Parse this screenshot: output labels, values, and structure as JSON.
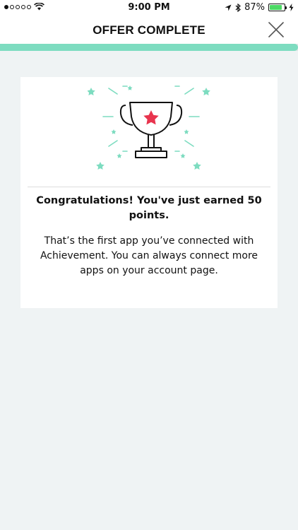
{
  "status_bar": {
    "time": "9:00 PM",
    "battery_percent": "87%",
    "battery_level": 0.87,
    "icons": [
      "signal-dots-icon",
      "wifi-icon",
      "location-arrow-icon",
      "bluetooth-icon",
      "battery-icon",
      "charging-bolt-icon"
    ]
  },
  "nav": {
    "title": "OFFER COMPLETE",
    "close_icon": "close-icon"
  },
  "progress": {
    "fraction": 1.0,
    "color": "#7ddcc0"
  },
  "card": {
    "illustration_icon": "trophy-star-icon",
    "headline": "Congratulations! You've just earned 50 points.",
    "body": "That’s the first app you’ve connected with Achievement. You can always connect more apps on your account page."
  },
  "colors": {
    "accent": "#7ddcc0",
    "star": "#e8344e",
    "background": "#eff3f4"
  }
}
